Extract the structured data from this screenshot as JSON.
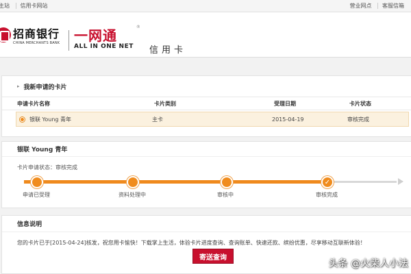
{
  "topbar": {
    "left": [
      "主站",
      "信用卡网站"
    ],
    "right": [
      "营业网点",
      "客服信箱"
    ]
  },
  "header": {
    "bank_cn": "招商银行",
    "bank_en": "CHINA MERCHANTS BANK",
    "product_cn": "一网通",
    "product_en": "ALL IN ONE NET",
    "section": "信用卡",
    "reg_mark": "®"
  },
  "cards_panel": {
    "title": "我新申请的卡片",
    "columns": [
      "申请卡片名称",
      "卡片类别",
      "受理日期",
      "卡片状态"
    ],
    "rows": [
      {
        "name": "银联 Young 青年",
        "type": "主卡",
        "date": "2015-04-19",
        "status": "审核完成"
      }
    ]
  },
  "progress_panel": {
    "title": "银联 Young 青年",
    "status_text": "卡片申请状态：审核完成",
    "steps": [
      "申请已受理",
      "资料处理中",
      "审核中",
      "审核完成"
    ],
    "completed_steps": 4
  },
  "info_panel": {
    "title": "信息说明",
    "text": "您的卡片已于[2015-04-24]核发，祝您用卡愉快！下载掌上生活，体验卡片进度查询、查询账单、快速还款、缤纷优惠，尽享移动互联新体验！",
    "button": "寄送查询"
  },
  "watermark": "头条 @火柴人小法",
  "colors": {
    "accent": "#ef8a1d",
    "brand": "#c8102e"
  }
}
